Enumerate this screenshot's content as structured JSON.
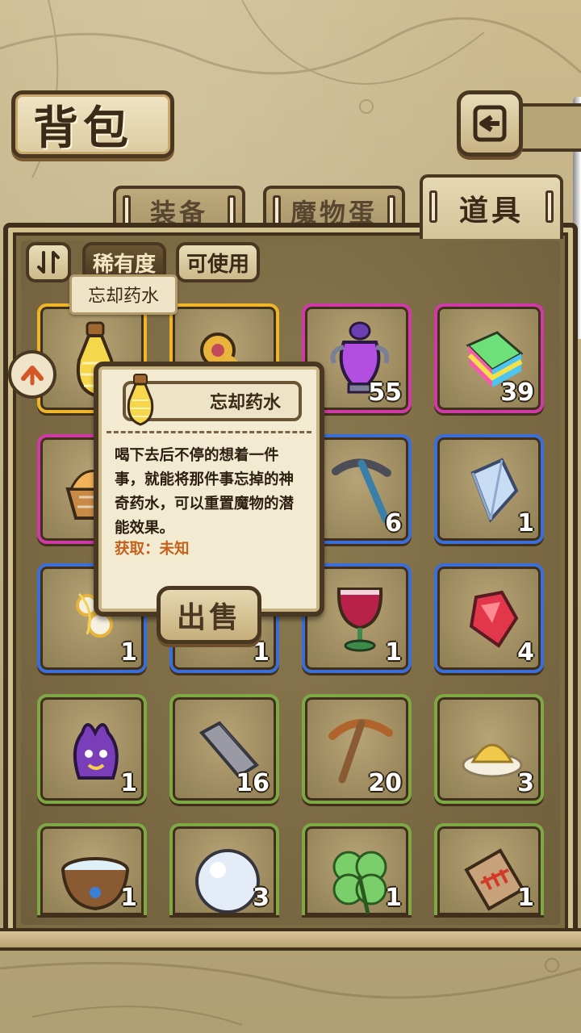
{
  "header": {
    "title": "背包"
  },
  "tabs": [
    {
      "label": "装备",
      "active": false
    },
    {
      "label": "魔物蛋",
      "active": false
    },
    {
      "label": "道具",
      "active": true
    }
  ],
  "filters": {
    "sort_label": "稀有度",
    "usable_label": "可使用",
    "hover_label": "忘却药水"
  },
  "tooltip": {
    "name": "忘却药水",
    "description": "喝下去后不停的想着一件事，就能将那件事忘掉的神奇药水，可以重置魔物的潜能效果。",
    "source": "获取：未知",
    "sell_label": "出售"
  },
  "items": [
    {
      "icon": "forget-potion-icon",
      "rarity": "gold",
      "count": ""
    },
    {
      "icon": "golden-key-icon",
      "rarity": "gold",
      "count": ""
    },
    {
      "icon": "purple-vase-icon",
      "rarity": "purple",
      "count": "55"
    },
    {
      "icon": "rainbow-block-icon",
      "rarity": "purple",
      "count": "39"
    },
    {
      "icon": "bread-basket-icon",
      "rarity": "purple",
      "count": ""
    },
    {
      "icon": "hidden-item-icon",
      "rarity": "blue",
      "count": ""
    },
    {
      "icon": "iron-pickaxe-icon",
      "rarity": "blue",
      "count": "6"
    },
    {
      "icon": "crystal-icon",
      "rarity": "blue",
      "count": "1"
    },
    {
      "icon": "bone-charm-icon",
      "rarity": "blue",
      "count": "1"
    },
    {
      "icon": "hidden-item-icon",
      "rarity": "blue",
      "count": "1"
    },
    {
      "icon": "red-goblet-icon",
      "rarity": "blue",
      "count": "1"
    },
    {
      "icon": "ruby-shard-icon",
      "rarity": "blue",
      "count": "4"
    },
    {
      "icon": "tentacle-monster-icon",
      "rarity": "green",
      "count": "1"
    },
    {
      "icon": "iron-bar-icon",
      "rarity": "green",
      "count": "16"
    },
    {
      "icon": "wooden-pickaxe-icon",
      "rarity": "green",
      "count": "20"
    },
    {
      "icon": "sand-pile-icon",
      "rarity": "green",
      "count": "3"
    },
    {
      "icon": "water-bowl-icon",
      "rarity": "green",
      "count": "1"
    },
    {
      "icon": "pearl-icon",
      "rarity": "green",
      "count": "3"
    },
    {
      "icon": "clover-icon",
      "rarity": "green",
      "count": "1"
    },
    {
      "icon": "fish-bone-tag-icon",
      "rarity": "green",
      "count": "1"
    }
  ],
  "colors": {
    "gold": "#f1b52a",
    "purple": "#cf3aa6",
    "blue": "#3a6fd8",
    "green": "#7ea843",
    "source_text": "#c4611a"
  }
}
